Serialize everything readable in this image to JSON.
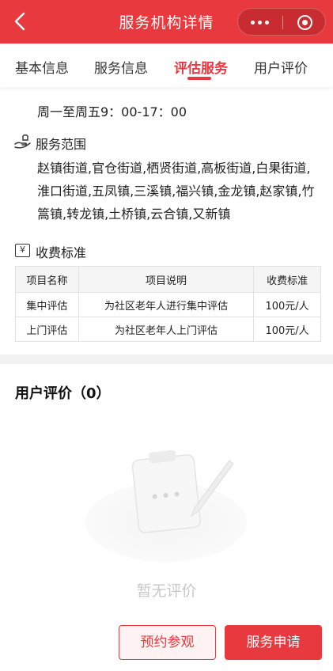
{
  "header": {
    "title": "服务机构详情",
    "back_icon": "chevron-left-icon",
    "capsule_icons": [
      "more-dots-icon",
      "close-target-icon"
    ],
    "brand_color": "#e8393e"
  },
  "tabs": [
    {
      "label": "基本信息",
      "active": false
    },
    {
      "label": "服务信息",
      "active": false
    },
    {
      "label": "评估服务",
      "active": true
    },
    {
      "label": "用户评价",
      "active": false
    }
  ],
  "service_hours": "周一至周五9：00-17：00",
  "service_scope": {
    "title": "服务范围",
    "icon": "hand-service-icon",
    "text": "赵镇街道,官仓街道,栖贤街道,高板街道,白果街道,淮口街道,五凤镇,三溪镇,福兴镇,金龙镇,赵家镇,竹篙镇,转龙镇,土桥镇,云合镇,又新镇"
  },
  "fees": {
    "title": "收费标准",
    "icon": "yen-icon",
    "icon_glyph": "¥",
    "headers": [
      "项目名称",
      "项目说明",
      "收费标准"
    ],
    "rows": [
      [
        "集中评估",
        "为社区老年人进行集中评估",
        "100元/人"
      ],
      [
        "上门评估",
        "为社区老年人上门评估",
        "100元/人"
      ]
    ]
  },
  "reviews": {
    "title": "用户评价（0）",
    "empty_text": "暂无评价",
    "empty_icon": "empty-clipboard-icon"
  },
  "actions": {
    "visit_label": "预约参观",
    "apply_label": "服务申请"
  }
}
